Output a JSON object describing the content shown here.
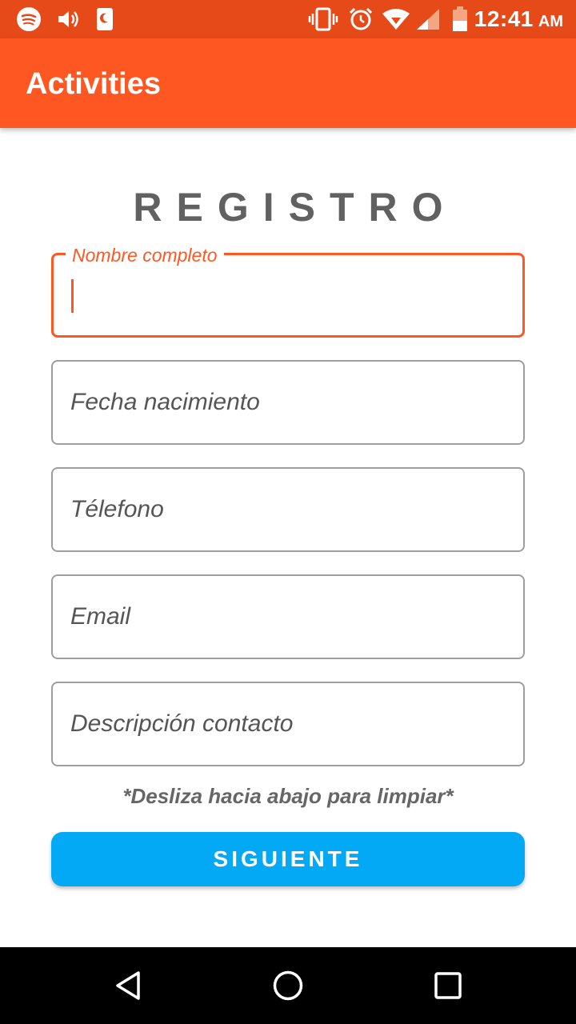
{
  "status_bar": {
    "time": "12:41",
    "ampm": "AM",
    "icons": [
      "spotify-icon",
      "volume-icon",
      "do-not-disturb-icon",
      "vibrate-icon",
      "alarm-icon",
      "wifi-icon",
      "signal-icon",
      "battery-icon"
    ]
  },
  "app_bar": {
    "title": "Activities"
  },
  "form": {
    "title": "REGISTRO",
    "fields": [
      {
        "label": "Nombre completo",
        "value": ""
      },
      {
        "placeholder": "Fecha nacimiento"
      },
      {
        "placeholder": "Télefono"
      },
      {
        "placeholder": "Email"
      },
      {
        "placeholder": "Descripción contacto"
      }
    ],
    "hint": "*Desliza hacia abajo para limpiar*",
    "next_button": "SIGUIENTE"
  },
  "colors": {
    "status_bar": "#e64a19",
    "app_bar": "#ff5722",
    "accent": "#ff5722",
    "button": "#03a9f4"
  },
  "nav_bar": {
    "buttons": [
      "back-icon",
      "home-icon",
      "recents-icon"
    ]
  }
}
